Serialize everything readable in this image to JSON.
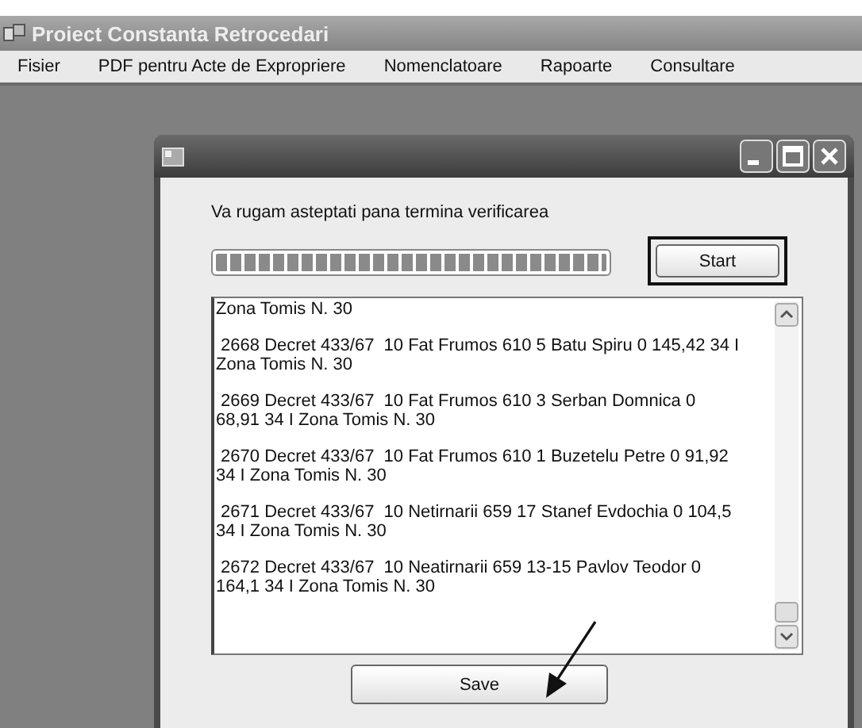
{
  "window": {
    "title": "Proiect Constanta Retrocedari"
  },
  "menu": [
    "Fisier",
    "PDF pentru Acte de Expropriere",
    "Nomenclatoare",
    "Rapoarte",
    "Consultare"
  ],
  "dialog": {
    "message": "Va rugam asteptati pana termina verificarea",
    "progress": {
      "level": 1
    },
    "start_button": {
      "label": "Start",
      "focused": true
    },
    "log": [
      {
        "lines": [
          "Zona Tomis N. 30"
        ]
      },
      {
        "lines": [
          " 2668 Decret 433/67  10 Fat Frumos 610 5 Batu Spiru 0 145,42 34 I",
          "Zona Tomis N. 30"
        ]
      },
      {
        "lines": [
          " 2669 Decret 433/67  10 Fat Frumos 610 3 Serban Domnica 0",
          "68,91 34 I Zona Tomis N. 30"
        ]
      },
      {
        "lines": [
          " 2670 Decret 433/67  10 Fat Frumos 610 1 Buzetelu Petre 0 91,92",
          "34 I Zona Tomis N. 30"
        ]
      },
      {
        "lines": [
          " 2671 Decret 433/67  10 Netirnarii 659 17 Stanef Evdochia 0 104,5",
          "34 I Zona Tomis N. 30"
        ]
      },
      {
        "lines": [
          " 2672 Decret 433/67  10 Neatirnarii 659 13-15 Pavlov Teodor 0",
          "164,1 34 I Zona Tomis N. 30"
        ]
      }
    ],
    "save_button": {
      "label": "Save"
    }
  }
}
